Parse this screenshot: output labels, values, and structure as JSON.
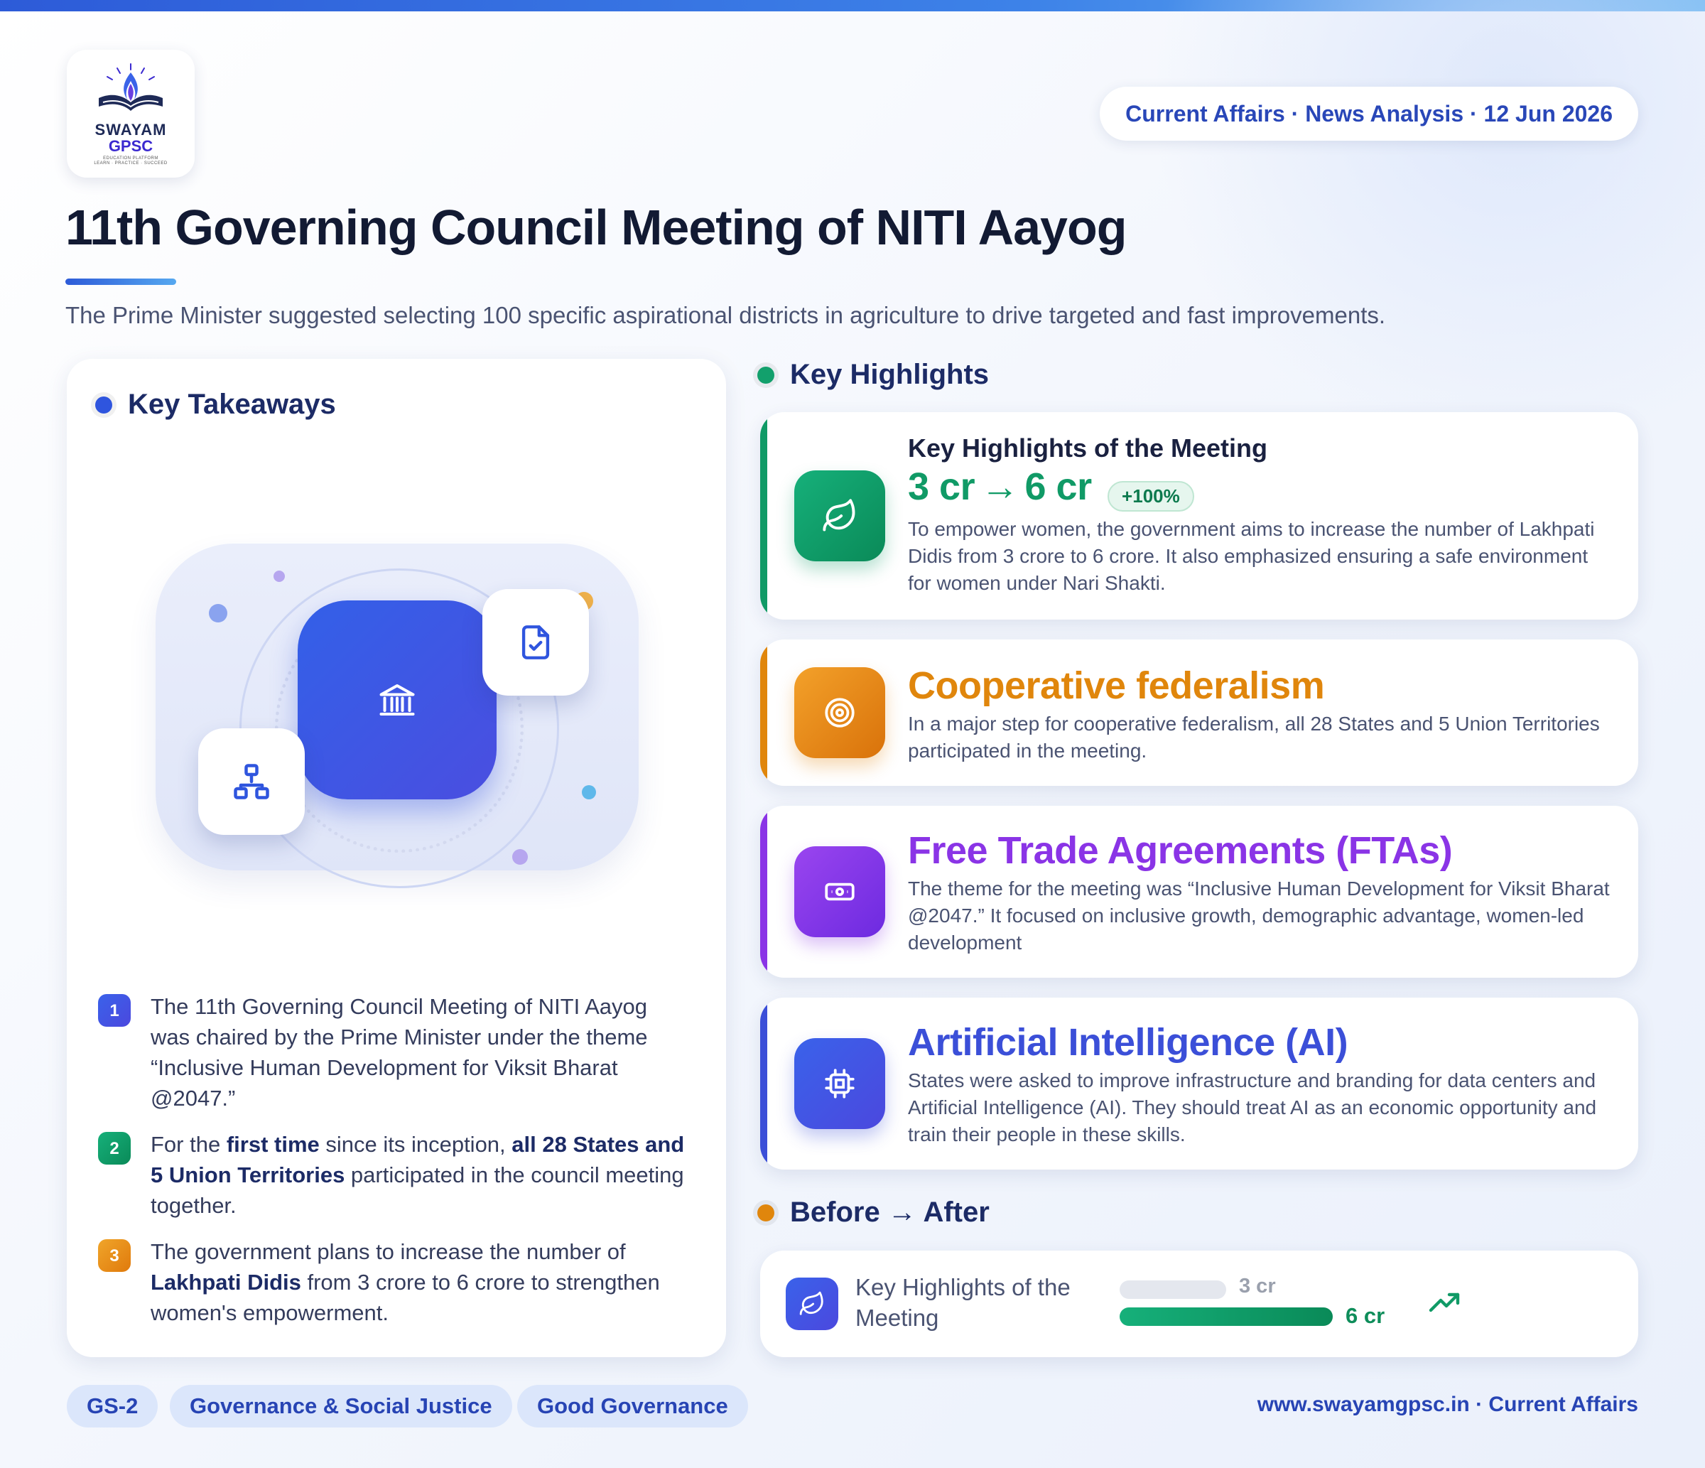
{
  "brand": {
    "logo_line1": "SWAYAM",
    "logo_line2": "GPSC",
    "logo_line3": "EDUCATION PLATFORM",
    "logo_line4": "LEARN · PRACTICE · SUCCEED"
  },
  "header": {
    "date_pill": "Current Affairs · News Analysis · 12 Jun 2026",
    "title": "11th Governing Council Meeting of NITI Aayog",
    "subtitle": "The Prime Minister suggested selecting 100 specific aspirational districts in agriculture to drive targeted and fast improvements."
  },
  "takeaways": {
    "heading": "Key Takeaways",
    "items": [
      {
        "num": "1",
        "text": "The 11th Governing Council Meeting of NITI Aayog was chaired by the Prime Minister under the theme “Inclusive Human Development for Viksit Bharat @2047.”"
      },
      {
        "num": "2",
        "parts": [
          "For the ",
          "first time",
          " since its inception, ",
          "all 28 States and 5 Union Territories",
          " participated in the council meeting together."
        ]
      },
      {
        "num": "3",
        "parts": [
          "The government plans to increase the number of ",
          "Lakhpati Didis",
          " from 3 crore to 6 crore to strengthen women's empowerment."
        ]
      }
    ]
  },
  "highlights": {
    "heading": "Key Highlights",
    "cards": [
      {
        "kicker": "Key Highlights of the Meeting",
        "big_from": "3 cr",
        "arrow": "→",
        "big_to": "6 cr",
        "badge": "+100%",
        "desc": "To empower women, the government aims to increase the number of Lakhpati Didis from 3 crore to 6 crore. It also emphasized ensuring a safe environment for women under Nari Shakti.",
        "icon": "leaf-icon",
        "color": "#109a66"
      },
      {
        "big": "Cooperative federalism",
        "desc": "In a major step for cooperative federalism, all 28 States and 5 Union Territories participated in the meeting.",
        "icon": "target-icon",
        "color": "#e0860c"
      },
      {
        "big": "Free Trade Agreements (FTAs)",
        "desc": "The theme for the meeting was “Inclusive Human Development for Viksit Bharat @2047.” It focused on inclusive growth, demographic advantage, women-led development",
        "icon": "banknote-icon",
        "color": "#8a34e6"
      },
      {
        "big": "Artificial Intelligence (AI)",
        "desc": "States were asked to improve infrastructure and branding for data centers and Artificial Intelligence (AI). They should treat AI as an economic opportunity and train their people in these skills.",
        "icon": "chip-icon",
        "color": "#3b4fd8"
      }
    ]
  },
  "before_after": {
    "heading": "Before → After",
    "label": "Key Highlights of the Meeting",
    "before_value": "3 cr",
    "after_value": "6 cr",
    "before_fraction": 0.5,
    "after_fraction": 1.0
  },
  "tags": [
    "GS-2",
    "Governance & Social Justice",
    "Good Governance"
  ],
  "footer": {
    "url": "www.swayamgpsc.in · Current Affairs"
  },
  "colors": {
    "accent": "#2947b8",
    "green": "#109a66",
    "orange": "#e0860c",
    "purple": "#8a34e6",
    "indigo": "#3b4fd8"
  }
}
